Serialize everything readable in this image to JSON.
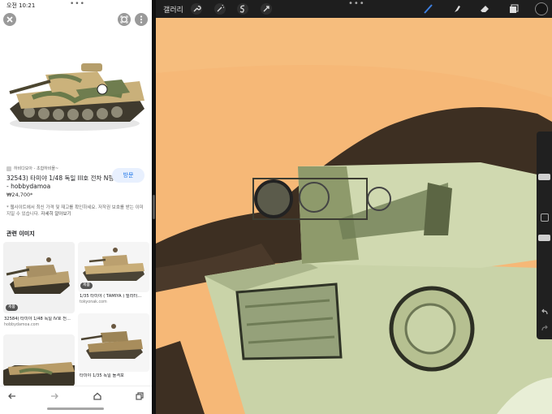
{
  "left_pane": {
    "status": {
      "time": "오전 10:21",
      "dots": "•••"
    },
    "source": "하비다모아 - 초합하비몰~",
    "title": "32543) 타미야 1/48 독일 III호 전차 N형 - hobbydamoa",
    "price": "₩24,700*",
    "visit_label": "방문",
    "note": "* 웹사이트에서 최신 가격 및 재고를 확인하세요. 저작권 보호를 받는 이미지일 수 있습니다.",
    "more_link": "자세히 알아보기",
    "related_title": "관련 이미지",
    "related": [
      {
        "caption": "32584) 타미야 1/48 독일 IV호 전...",
        "domain": "hobbydamoa.com",
        "badge": "제품"
      },
      {
        "caption": "1/35 타미야 ( TAMIYA ) 밀리터...",
        "domain": "tokyonak.com",
        "badge": "제품"
      },
      {
        "caption": "",
        "domain": ""
      },
      {
        "caption": "타미야 1/35 독일 돌격포",
        "domain": ""
      }
    ],
    "icons": {
      "close": "close-icon",
      "lens": "lens-icon",
      "more": "more-vert-icon",
      "back": "back-arrow-icon",
      "forward": "forward-arrow-icon",
      "home": "home-icon",
      "tabs": "tabs-icon"
    }
  },
  "procreate": {
    "gallery_label": "갤러리",
    "dots": "•••",
    "colors": {
      "background": "#f6b877",
      "hair": "#3d2f22",
      "green_light": "#c9d3a8",
      "green_dark": "#6f7d55"
    }
  }
}
